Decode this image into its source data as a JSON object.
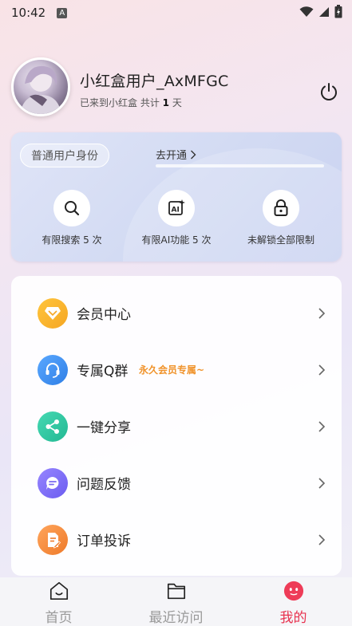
{
  "status_bar": {
    "time": "10:42",
    "notification_letter": "A"
  },
  "profile": {
    "username": "小红盒用户_AxMFGC",
    "joined_prefix": "已来到小红盒 共计",
    "joined_days": "1",
    "joined_suffix": "天"
  },
  "membership": {
    "identity_label": "普通用户身份",
    "upgrade_label": "去开通",
    "progress": 0,
    "features": [
      {
        "icon": "search-icon",
        "label": "有限搜索 5 次"
      },
      {
        "icon": "ai-icon",
        "label": "有限AI功能 5 次"
      },
      {
        "icon": "lock-icon",
        "label": "未解锁全部限制"
      }
    ]
  },
  "menu": {
    "items": [
      {
        "icon": "vip-diamond-icon",
        "label": "会员中心",
        "color": "#f5a623"
      },
      {
        "icon": "headset-icon",
        "label": "专属Q群",
        "tag": "永久会员专属~",
        "color": "#3b8ff0"
      },
      {
        "icon": "share-icon",
        "label": "一键分享",
        "color": "#2ec4a0"
      },
      {
        "icon": "feedback-icon",
        "label": "问题反馈",
        "color": "#7a6af0"
      },
      {
        "icon": "complaint-icon",
        "label": "订单投诉",
        "color": "#f08a3c"
      }
    ]
  },
  "tabbar": {
    "tabs": [
      {
        "label": "首页",
        "icon": "home-icon",
        "active": false
      },
      {
        "label": "最近访问",
        "icon": "folder-icon",
        "active": false
      },
      {
        "label": "我的",
        "icon": "profile-face-icon",
        "active": true
      }
    ],
    "active_color": "#e8324f"
  }
}
